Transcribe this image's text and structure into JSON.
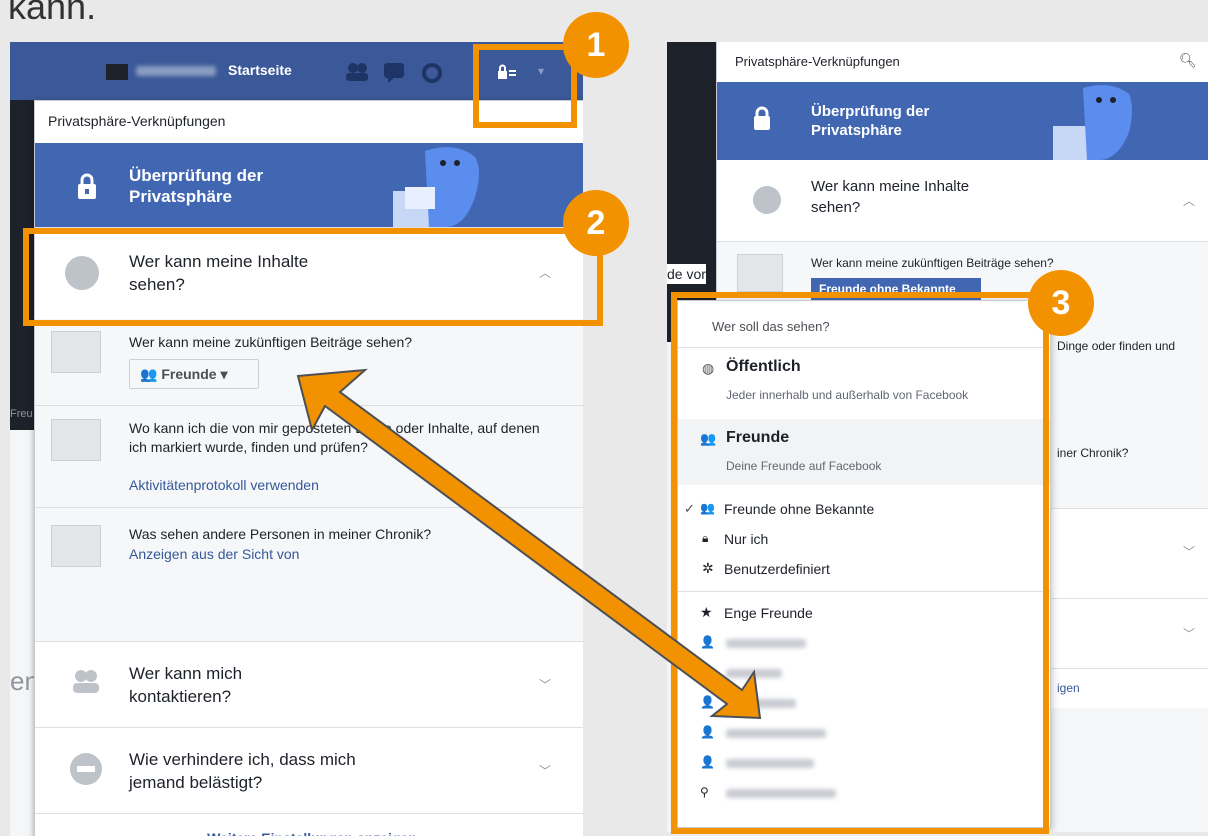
{
  "caption_fragment": "kann.",
  "left": {
    "topbar": {
      "home_label": "Startseite"
    },
    "menu": {
      "header": "Privatsphäre-Verknüpfungen",
      "privacy_check_title": "Überprüfung der Privatsphäre",
      "who_can_see": "Wer kann meine Inhalte sehen?",
      "future_posts_q": "Wer kann meine zukünftigen Beiträge sehen?",
      "future_posts_btn": "Freunde",
      "where_q": "Wo kann ich die von mir geposteten Dinge oder Inhalte, auf denen ich markiert wurde, finden und prüfen?",
      "activity_link": "Aktivitätenprotokoll verwenden",
      "timeline_q": "Was sehen andere Personen in meiner Chronik?",
      "view_as_link": "Anzeigen aus der Sicht von",
      "contact_q": "Wer kann mich kontaktieren?",
      "harass_q": "Wie verhindere ich, dass mich jemand belästigt?",
      "more_settings": "Weitere Einstellungen anzeigen"
    },
    "bg_fragments": [
      "vor",
      "Freu",
      "en"
    ]
  },
  "right": {
    "menu": {
      "header": "Privatsphäre-Verknüpfungen",
      "privacy_check_title": "Überprüfung der Privatsphäre",
      "who_can_see": "Wer kann meine Inhalte sehen?",
      "future_posts_q": "Wer kann meine zukünftigen Beiträge sehen?",
      "current_btn": "Freunde ohne Bekannte",
      "frag_dinge": "Dinge oder finden und",
      "frag_chronik": "iner Chronik?",
      "frag_igen": "igen",
      "bg_fragment": "de vor"
    },
    "dropdown": {
      "title": "Wer soll das sehen?",
      "public_label": "Öffentlich",
      "public_desc": "Jeder innerhalb und außerhalb von Facebook",
      "friends_label": "Freunde",
      "friends_desc": "Deine Freunde auf Facebook",
      "fwa_label": "Freunde ohne Bekannte",
      "onlyme_label": "Nur ich",
      "custom_label": "Benutzerdefiniert",
      "close_friends_label": "Enge Freunde"
    }
  },
  "badges": [
    "1",
    "2",
    "3"
  ],
  "colors": {
    "fb_blue": "#4267b2",
    "accent_orange": "#f39200"
  }
}
